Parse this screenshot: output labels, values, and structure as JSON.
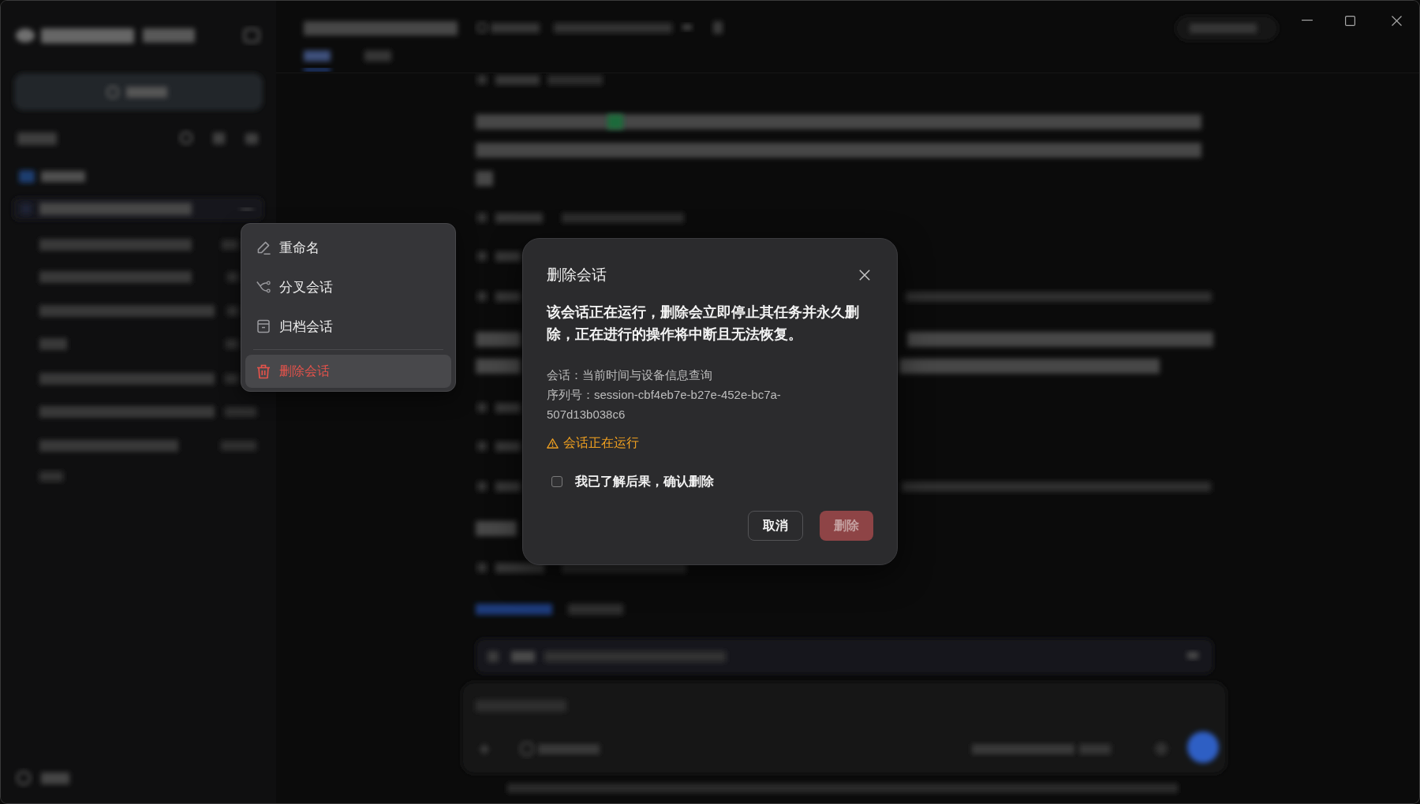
{
  "context_menu": {
    "items": [
      {
        "kind": "rename",
        "label": "重命名",
        "selected": false
      },
      {
        "kind": "fork",
        "label": "分叉会话",
        "selected": false
      },
      {
        "kind": "archive",
        "label": "归档会话",
        "selected": false
      },
      {
        "kind": "delete",
        "label": "删除会话",
        "selected": true
      }
    ]
  },
  "dialog": {
    "title": "删除会话",
    "message": "该会话正在运行，删除会立即停止其任务并永久删除，正在进行的操作将中断且无法恢复。",
    "details": [
      "会话：当前时间与设备信息查询",
      "序列号：session-cbf4eb7e-b27e-452e-bc7a-507d13b038c6"
    ],
    "warning": "会话正在运行",
    "confirm": {
      "label": "我已了解后果，确认删除",
      "checked": false
    },
    "buttons": [
      {
        "kind": "cancel",
        "label": "取消",
        "disabled": false
      },
      {
        "kind": "delete",
        "label": "删除",
        "disabled": true
      }
    ]
  }
}
